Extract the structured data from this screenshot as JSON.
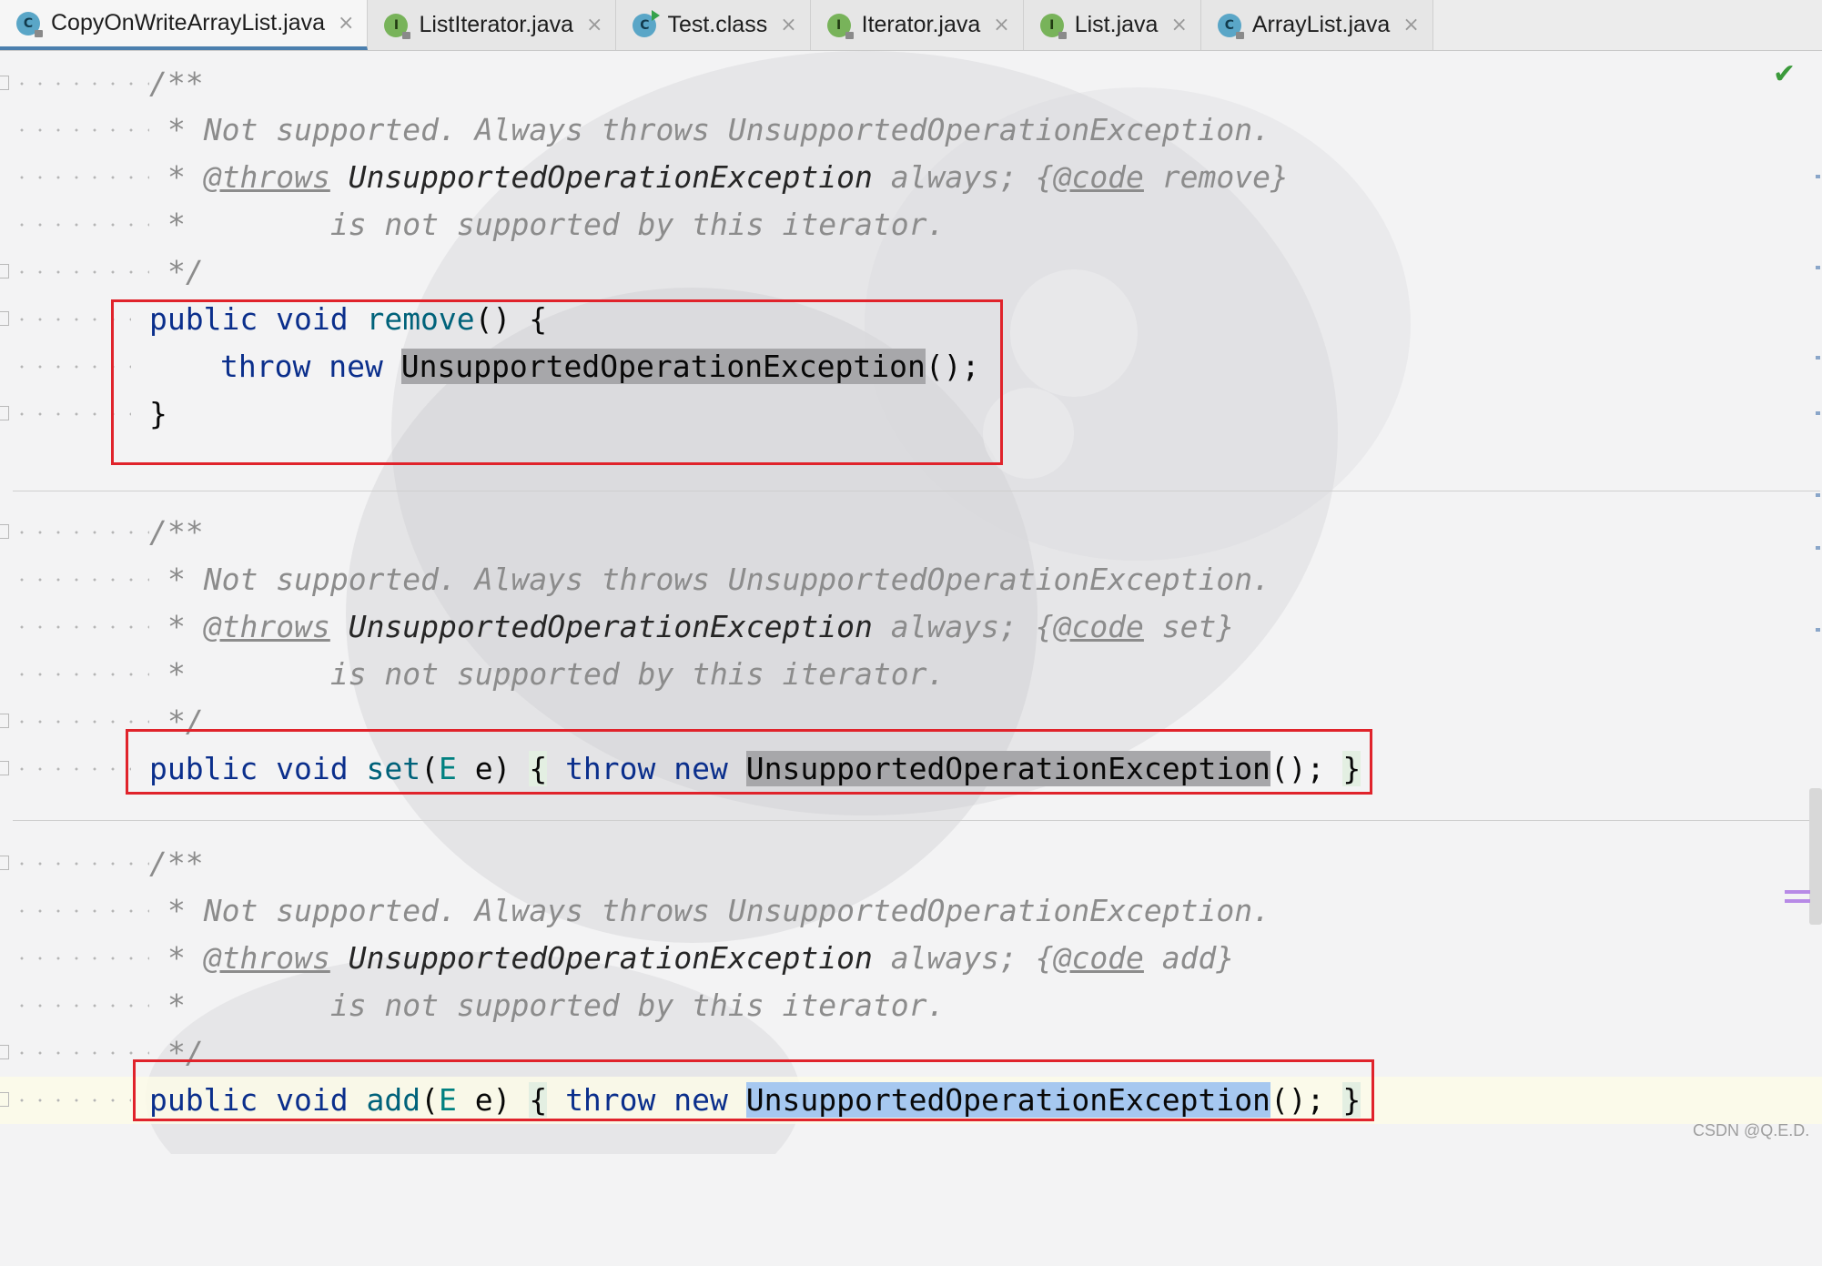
{
  "tabs": [
    {
      "label": "CopyOnWriteArrayList.java",
      "icon": "class-icon",
      "icon_letter": "C",
      "kind": "c",
      "active": true
    },
    {
      "label": "ListIterator.java",
      "icon": "interface-icon",
      "icon_letter": "I",
      "kind": "i",
      "active": false
    },
    {
      "label": "Test.class",
      "icon": "class-run-icon",
      "icon_letter": "C",
      "kind": "c",
      "active": false
    },
    {
      "label": "Iterator.java",
      "icon": "interface-icon",
      "icon_letter": "I",
      "kind": "i",
      "active": false
    },
    {
      "label": "List.java",
      "icon": "interface-icon",
      "icon_letter": "I",
      "kind": "i",
      "active": false
    },
    {
      "label": "ArrayList.java",
      "icon": "class-icon",
      "icon_letter": "C",
      "kind": "c",
      "active": false
    }
  ],
  "tab_close_glyph": "×",
  "code": {
    "doc_open": "/**",
    "doc_close": "*/",
    "star": "*",
    "not_supported": "Not supported. Always throws UnsupportedOperationException.",
    "throws_tag": "@throws",
    "exception": "UnsupportedOperationException",
    "always": "always;",
    "brace_open": "{",
    "code_tag": "@code",
    "not_supported_by": "is not supported by this iterator.",
    "remove_ref": "remove}",
    "set_ref": "set}",
    "add_ref": "add}",
    "kw_public": "public",
    "kw_void": "void",
    "kw_throw": "throw",
    "kw_new": "new",
    "remove_name": "remove",
    "remove_sig": "() {",
    "parens_semi": "();",
    "close_brace": "}",
    "set_name": "set",
    "add_name": "add",
    "param_open": "(",
    "param_type": "E",
    "param_name": "e)",
    "brace_close": "}"
  },
  "status": {
    "check": "✔",
    "watermark": "CSDN @Q.E.D."
  },
  "colors": {
    "keyword": "#0b2f8c",
    "method": "#00627a",
    "comment": "#8c8c8c",
    "highlight_gray": "#a7a7aa",
    "highlight_blue": "#a6c8f0",
    "red_box": "#e0232b"
  }
}
